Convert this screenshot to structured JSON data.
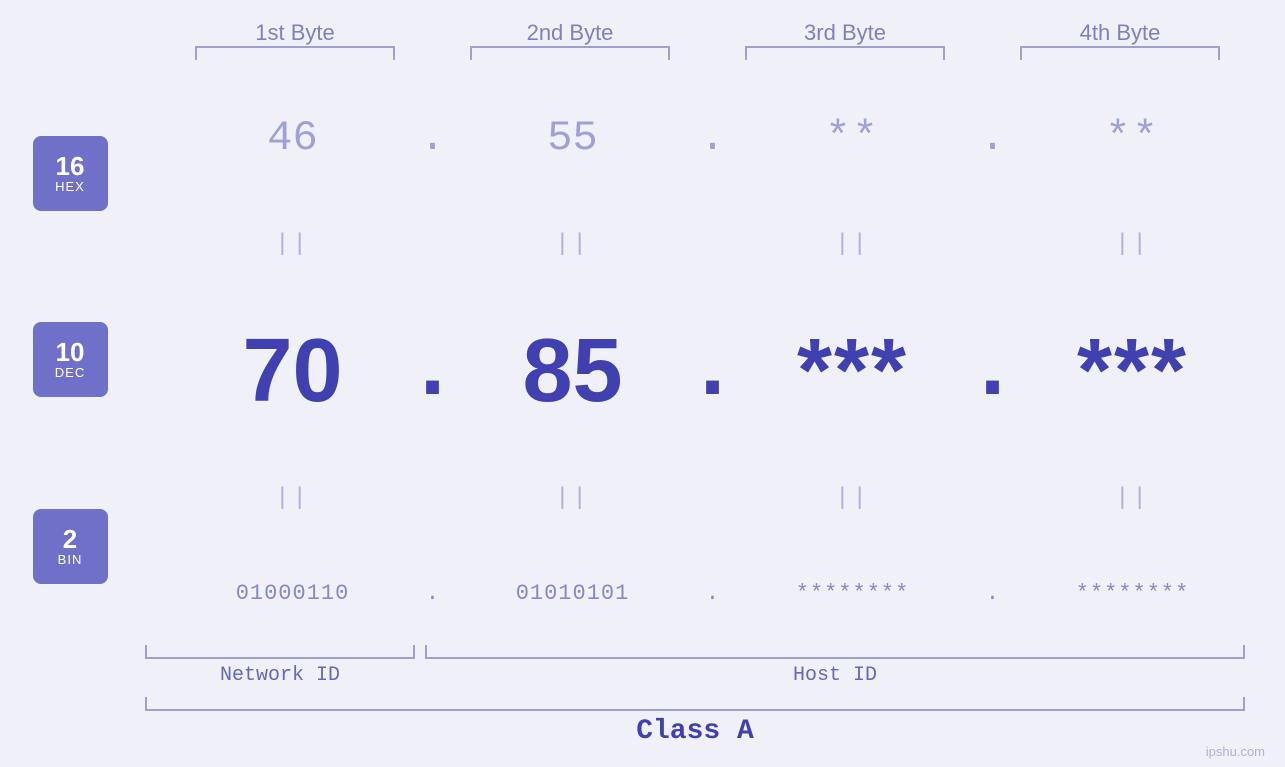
{
  "headers": {
    "byte1": "1st Byte",
    "byte2": "2nd Byte",
    "byte3": "3rd Byte",
    "byte4": "4th Byte"
  },
  "badges": {
    "hex": {
      "num": "16",
      "label": "HEX"
    },
    "dec": {
      "num": "10",
      "label": "DEC"
    },
    "bin": {
      "num": "2",
      "label": "BIN"
    }
  },
  "hex": {
    "b1": "46",
    "b2": "55",
    "b3": "**",
    "b4": "**",
    "dot": "."
  },
  "dec": {
    "b1": "70",
    "b2": "85",
    "b3": "***",
    "b4": "***",
    "dot": "."
  },
  "bin": {
    "b1": "01000110",
    "b2": "01010101",
    "b3": "********",
    "b4": "********",
    "dot": "."
  },
  "labels": {
    "network_id": "Network ID",
    "host_id": "Host ID",
    "class": "Class A"
  },
  "watermark": "ipshu.com"
}
